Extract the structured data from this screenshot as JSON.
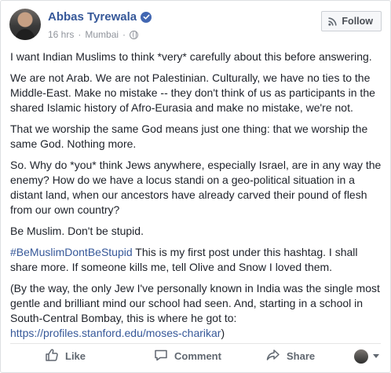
{
  "post": {
    "author": "Abbas Tyrewala",
    "time": "16 hrs",
    "location": "Mumbai",
    "follow_label": "Follow",
    "paragraphs": [
      "I want Indian Muslims to think *very* carefully about this before answering.",
      "We are not Arab. We are not Palestinian. Culturally, we have no ties to the Middle-East. Make no mistake -- they don't think of us as participants in the shared Islamic history of Afro-Eurasia and make no mistake, we're not.",
      "That we worship the same God means just one thing: that we worship the same God. Nothing more.",
      "So. Why do *you* think Jews anywhere, especially Israel, are in any way the enemy? How do we have a locus standi on a geo-political situation in a distant land, when our ancestors have already carved their pound of flesh from our own country?",
      "Be Muslim. Don't be stupid."
    ],
    "hashtag": "#BeMuslimDontBeStupid",
    "hashtag_text": " This is my first post under this hashtag. I shall share more. If someone kills me, tell Olive and Snow I loved them.",
    "last_paragraph": "(By the way, the only Jew I've personally known in India was the single most gentle and brilliant mind our school had seen. And, starting in a school in South-Central Bombay, this is where he got to: ",
    "link_text": "https://profiles.stanford.edu/moses-charikar",
    "link_suffix": ")"
  },
  "actions": {
    "like": "Like",
    "comment": "Comment",
    "share": "Share"
  },
  "colors": {
    "author": "#365899",
    "link": "#365899",
    "verified": "#4267b2",
    "meta": "#90949c",
    "action": "#606770"
  }
}
